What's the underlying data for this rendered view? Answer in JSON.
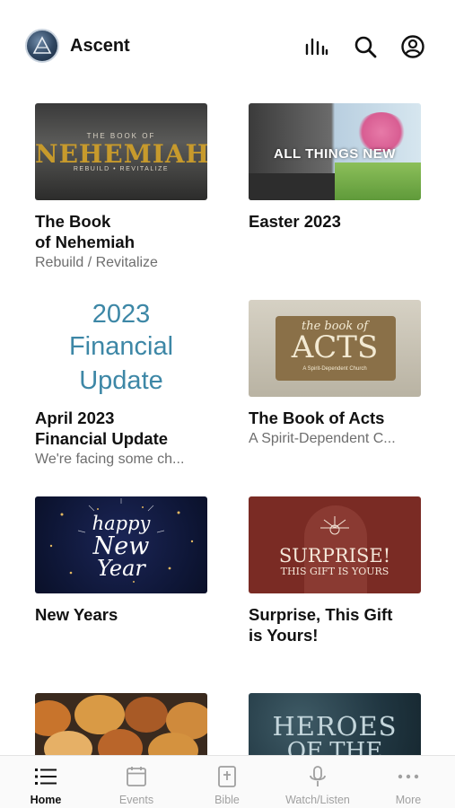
{
  "app": {
    "title": "Ascent"
  },
  "header": {
    "icons": [
      "stats-bars-icon",
      "search-icon",
      "account-icon"
    ]
  },
  "cards": [
    {
      "title": "The Book\nof Nehemiah",
      "subtitle": "Rebuild / Revitalize",
      "thumb": {
        "small": "THE BOOK OF",
        "big": "NEHEMIAH",
        "tag": "REBUILD • REVITALIZE"
      }
    },
    {
      "title": "Easter 2023",
      "subtitle": "",
      "thumb": {
        "text": "ALL THINGS NEW"
      }
    },
    {
      "title": "April 2023\nFinancial Update",
      "subtitle": "We're facing some ch...",
      "thumb": {
        "line1": "2023",
        "line2": "Financial",
        "line3": "Update"
      }
    },
    {
      "title": "The Book of Acts",
      "subtitle": "A Spirit-Dependent C...",
      "thumb": {
        "line1": "the book of",
        "line2": "ACTS",
        "line3": "A Spirit-Dependent Church"
      }
    },
    {
      "title": "New Years",
      "subtitle": "",
      "thumb": {
        "line1": "happy",
        "line2": "New",
        "line3": "Year"
      }
    },
    {
      "title": "Surprise, This Gift\nis Yours!",
      "subtitle": "",
      "thumb": {
        "line1": "SURPRISE!",
        "line2": "THIS GIFT IS YOURS"
      }
    },
    {
      "title": "",
      "subtitle": "",
      "thumb": {}
    },
    {
      "title": "",
      "subtitle": "",
      "thumb": {
        "line1": "HEROES",
        "line2": "OF THE BIBLE"
      }
    }
  ],
  "tabs": [
    {
      "label": "Home",
      "icon": "list-icon",
      "active": true
    },
    {
      "label": "Events",
      "icon": "calendar-icon",
      "active": false
    },
    {
      "label": "Bible",
      "icon": "bible-icon",
      "active": false
    },
    {
      "label": "Watch/Listen",
      "icon": "microphone-icon",
      "active": false
    },
    {
      "label": "More",
      "icon": "more-dots-icon",
      "active": false
    }
  ],
  "colors": {
    "accent_text": "#111111",
    "muted_text": "#6e6e6e",
    "tab_inactive": "#a0a0a0"
  }
}
